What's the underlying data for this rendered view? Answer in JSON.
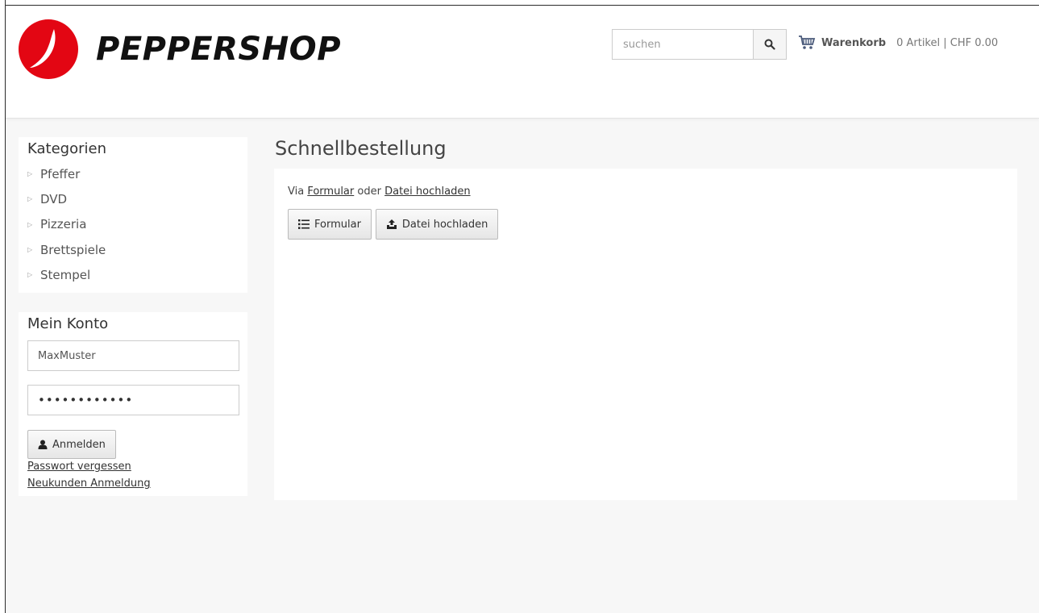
{
  "header": {
    "logo_text": "PEPPERSHOP",
    "brand_color": "#e30613",
    "search_placeholder": "suchen",
    "cart_title": "Warenkorb",
    "cart_info": "0 Artikel | CHF 0.00"
  },
  "sidebar": {
    "categories_title": "Kategorien",
    "categories": [
      "Pfeffer",
      "DVD",
      "Pizzeria",
      "Brettspiele",
      "Stempel"
    ],
    "account_title": "Mein Konto",
    "username_value": "MaxMuster",
    "password_value": "••••••••••••",
    "login_label": "Anmelden",
    "forgot_password": "Passwort vergessen",
    "register": "Neukunden Anmeldung"
  },
  "main": {
    "title": "Schnellbestellung",
    "via_prefix": "Via",
    "via_link_form": "Formular",
    "via_middle": "oder",
    "via_link_upload": "Datei hochladen",
    "form_button": "Formular",
    "upload_button": "Datei hochladen"
  },
  "icons": {
    "search": "search-icon",
    "cart": "cart-icon",
    "user": "user-icon",
    "list": "list-icon",
    "upload": "upload-icon"
  }
}
